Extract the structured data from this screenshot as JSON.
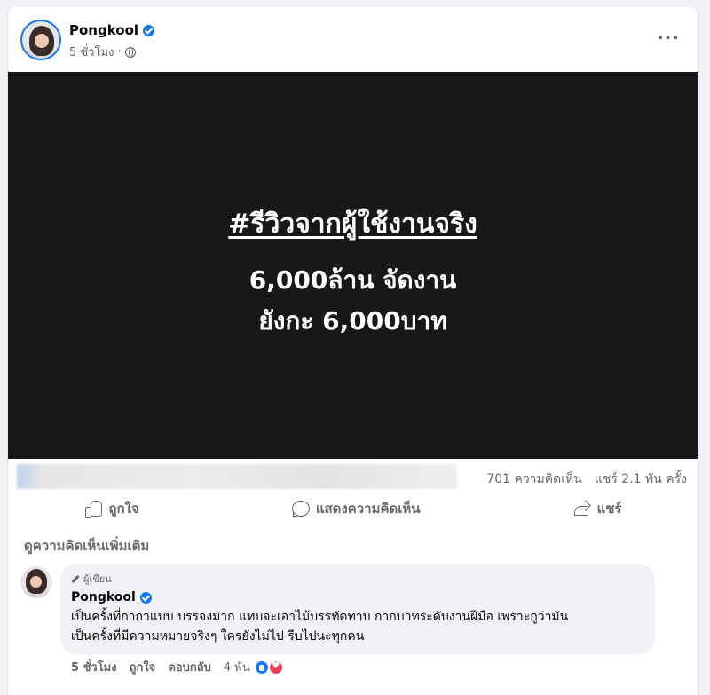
{
  "post": {
    "author": "Pongkool",
    "time": "5 ชั่วโมง",
    "media": {
      "title": "#รีวิวจากผู้ใช้งานจริง",
      "line1": "6,000ล้าน จัดงาน",
      "line2": "ยังกะ 6,000บาท"
    },
    "stats": {
      "comments": "701 ความคิดเห็น",
      "shares": "แชร์ 2.1 พัน ครั้ง"
    },
    "actions": {
      "like": "ถูกใจ",
      "comment": "แสดงความคิดเห็น",
      "share": "แชร์"
    }
  },
  "comments": {
    "view_more": "ดูความคิดเห็นเพิ่มเติม",
    "items": [
      {
        "badge": "ผู้เขียน",
        "author": "Pongkool",
        "text_line1": "เป็นครั้งที่กากาแบบ บรรจงมาก แทบจะเอาไม้บรรทัดทาบ กากบาทระดับงานฝีมือ เพราะกูว่ามัน",
        "text_line2": "เป็นครั้งที่มีความหมายจริงๆ ใครยังไม่ไป รีบไปนะทุกคน",
        "time": "5 ชั่วโมง",
        "like_label": "ถูกใจ",
        "reply_label": "ตอบกลับ",
        "reactions": "4 พัน"
      }
    ]
  },
  "colors": {
    "accent": "#1877f2",
    "muted": "#65676b",
    "media_bg": "#181818",
    "heart": "#f33e58"
  }
}
